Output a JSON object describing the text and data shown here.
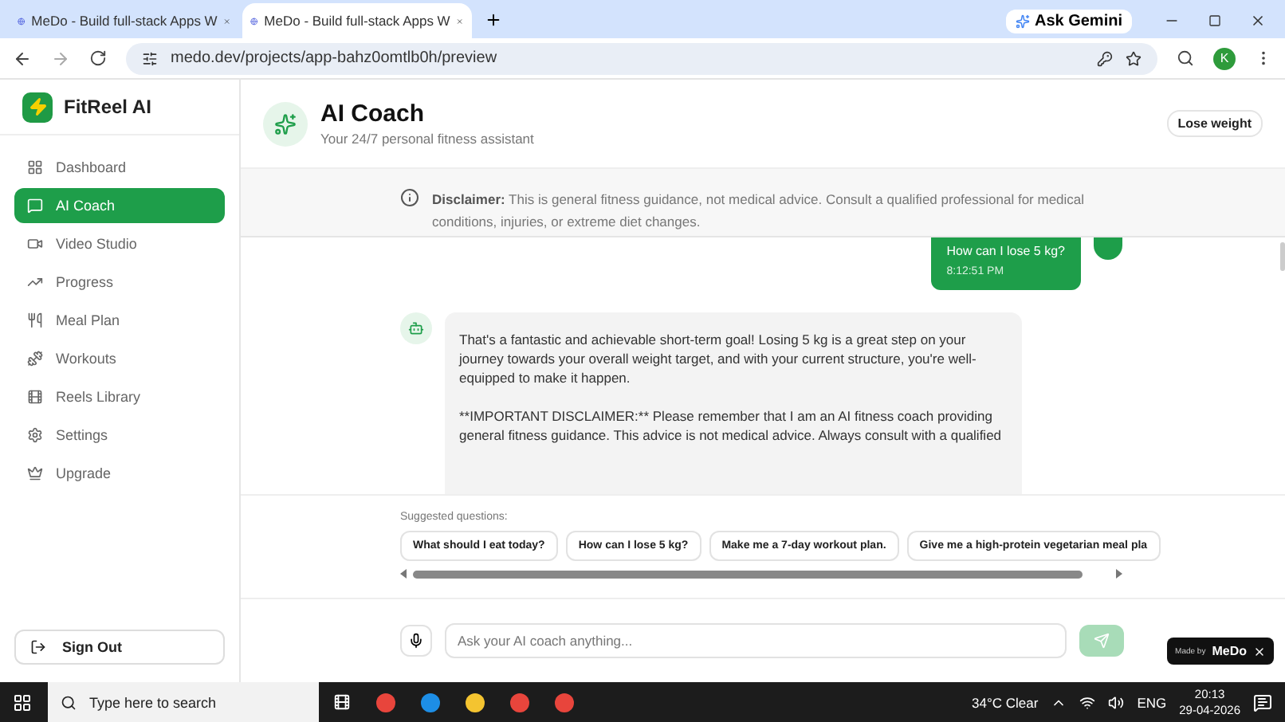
{
  "browser": {
    "tabs": [
      {
        "title": "MeDo - Build full-stack Apps W",
        "selected": false
      },
      {
        "title": "MeDo - Build full-stack Apps W",
        "selected": true
      }
    ],
    "gemini": "Ask Gemini",
    "url": "medo.dev/projects/app-bahz0omtlb0h/preview",
    "profile": "K"
  },
  "sidebar": {
    "brand": "FitReel AI",
    "items": [
      {
        "label": "Dashboard",
        "selected": false
      },
      {
        "label": "AI Coach",
        "selected": true
      },
      {
        "label": "Video Studio",
        "selected": false
      },
      {
        "label": "Progress",
        "selected": false
      },
      {
        "label": "Meal Plan",
        "selected": false
      },
      {
        "label": "Workouts",
        "selected": false
      },
      {
        "label": "Reels Library",
        "selected": false
      },
      {
        "label": "Settings",
        "selected": false
      },
      {
        "label": "Upgrade",
        "selected": false
      }
    ],
    "sign_out": "Sign Out"
  },
  "header": {
    "title": "AI Coach",
    "subtitle": "Your 24/7 personal fitness assistant",
    "goal": "Lose weight"
  },
  "disclaimer": "**Disclaimer:** This is general fitness guidance, not medical advice. Consult a qualified professional for medical conditions, injuries, or extreme diet changes.",
  "messages": [
    {
      "kind": "user",
      "text": "How can I lose 5 kg?",
      "time": "8:12:51 PM"
    },
    {
      "kind": "assistant",
      "paragraphs": [
        "That's a fantastic and achievable short-term goal! Losing 5 kg is a great step on your journey towards your overall weight target, and with your current structure, you're well-equipped to make it happen.",
        "**IMPORTANT DISCLAIMER:** Please remember that I am an AI fitness coach providing general fitness guidance. This advice is not medical advice. Always consult with a qualified"
      ]
    }
  ],
  "suggestions": {
    "label": "Suggested questions:",
    "items": [
      "What should I eat today?",
      "How can I lose 5 kg?",
      "Make me a 7-day workout plan.",
      "Give me a high-protein vegetarian meal pla"
    ]
  },
  "composer": {
    "placeholder": "Ask your AI coach anything..."
  },
  "badge": {
    "text": "Made by",
    "brand": "MeDo"
  },
  "taskbar": {
    "search": "Type here to search",
    "weather": "34°C  Clear",
    "lang": "ENG",
    "time": "20:13",
    "date": "29-04-2026"
  }
}
